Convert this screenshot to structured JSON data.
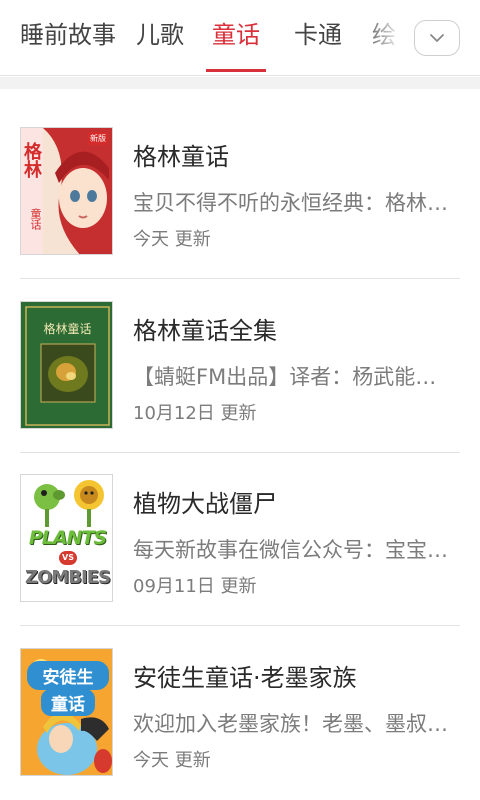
{
  "tabs": [
    {
      "label": "睡前故事",
      "active": false
    },
    {
      "label": "儿歌",
      "active": false
    },
    {
      "label": "童话",
      "active": true
    },
    {
      "label": "卡通",
      "active": false
    },
    {
      "label": "绘",
      "active": false
    }
  ],
  "more_icon": "chevron-down-icon",
  "colors": {
    "accent": "#d8313b",
    "text_primary": "#2a2a2a",
    "text_secondary": "#7c7c7c"
  },
  "albums": [
    {
      "title": "格林童话",
      "description": "宝贝不得不听的永恒经典：格林童话",
      "updated": "今天 更新",
      "cover": {
        "text": "格林",
        "subtext": "童话",
        "badge": "新版"
      }
    },
    {
      "title": "格林童话全集",
      "description": "【蜻蜓FM出品】译者：杨武能《格林童话全集》",
      "updated": "10月12日 更新",
      "cover": {
        "text": "格林童话"
      }
    },
    {
      "title": "植物大战僵尸",
      "description": "每天新故事在微信公众号：宝宝加油",
      "updated": "09月11日 更新",
      "cover": {
        "text": "PLANTS",
        "vs": "VS",
        "subtext": "ZOMBIES"
      }
    },
    {
      "title": "安徒生童话·老墨家族",
      "description": "欢迎加入老墨家族！老墨、墨叔叔讲故事",
      "updated": "今天 更新",
      "cover": {
        "text": "安徒生",
        "subtext": "童话"
      }
    }
  ]
}
